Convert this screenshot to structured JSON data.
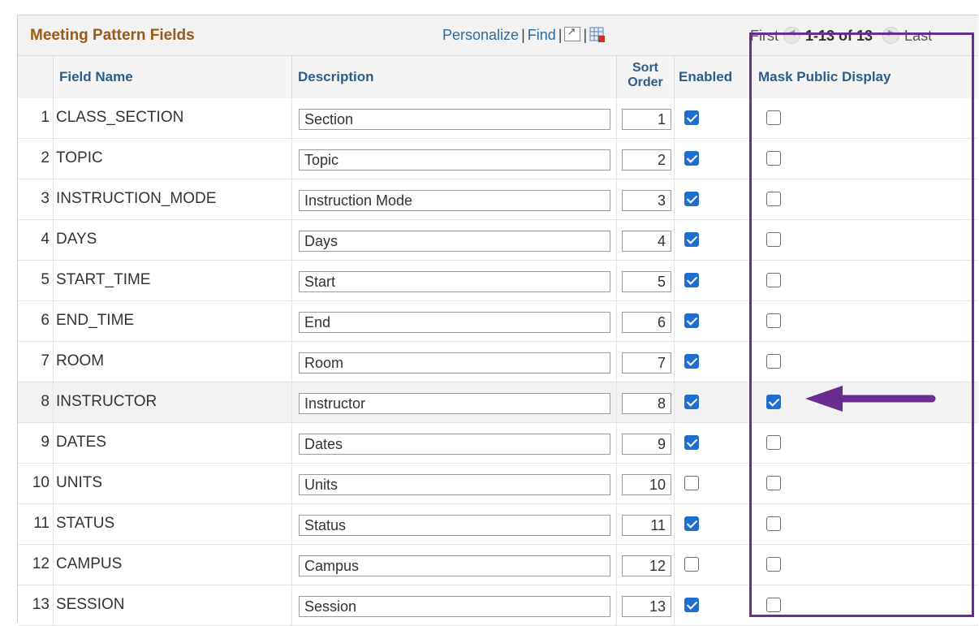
{
  "grid": {
    "title": "Meeting Pattern Fields",
    "toolbar": {
      "personalize": "Personalize",
      "find": "Find",
      "separator": "|"
    },
    "navigation": {
      "first": "First",
      "range": "1-13 of 13",
      "last": "Last"
    }
  },
  "columns": {
    "field_name": "Field Name",
    "description": "Description",
    "sort_order": "Sort Order",
    "enabled": "Enabled",
    "mask_public_display": "Mask Public Display"
  },
  "rows": [
    {
      "num": "1",
      "field": "CLASS_SECTION",
      "description": "Section",
      "sort": "1",
      "enabled": true,
      "mask": false
    },
    {
      "num": "2",
      "field": "TOPIC",
      "description": "Topic",
      "sort": "2",
      "enabled": true,
      "mask": false
    },
    {
      "num": "3",
      "field": "INSTRUCTION_MODE",
      "description": "Instruction Mode",
      "sort": "3",
      "enabled": true,
      "mask": false
    },
    {
      "num": "4",
      "field": "DAYS",
      "description": "Days",
      "sort": "4",
      "enabled": true,
      "mask": false
    },
    {
      "num": "5",
      "field": "START_TIME",
      "description": "Start",
      "sort": "5",
      "enabled": true,
      "mask": false
    },
    {
      "num": "6",
      "field": "END_TIME",
      "description": "End",
      "sort": "6",
      "enabled": true,
      "mask": false
    },
    {
      "num": "7",
      "field": "ROOM",
      "description": "Room",
      "sort": "7",
      "enabled": true,
      "mask": false
    },
    {
      "num": "8",
      "field": "INSTRUCTOR",
      "description": "Instructor",
      "sort": "8",
      "enabled": true,
      "mask": true,
      "highlighted": true
    },
    {
      "num": "9",
      "field": "DATES",
      "description": "Dates",
      "sort": "9",
      "enabled": true,
      "mask": false
    },
    {
      "num": "10",
      "field": "UNITS",
      "description": "Units",
      "sort": "10",
      "enabled": false,
      "mask": false
    },
    {
      "num": "11",
      "field": "STATUS",
      "description": "Status",
      "sort": "11",
      "enabled": true,
      "mask": false
    },
    {
      "num": "12",
      "field": "CAMPUS",
      "description": "Campus",
      "sort": "12",
      "enabled": false,
      "mask": false
    },
    {
      "num": "13",
      "field": "SESSION",
      "description": "Session",
      "sort": "13",
      "enabled": true,
      "mask": false
    }
  ],
  "icons": {
    "zoom": "zoom-icon",
    "download": "download-excel-icon",
    "prev": "previous-icon",
    "next": "next-icon",
    "annotation_arrow": "arrow-left-icon"
  },
  "colors": {
    "title": "#9c5a12",
    "link": "#2c6ca3",
    "checkbox_checked": "#1f6fd1",
    "annotation": "#6a2c91",
    "highlight_row": "#f2f2f2"
  }
}
